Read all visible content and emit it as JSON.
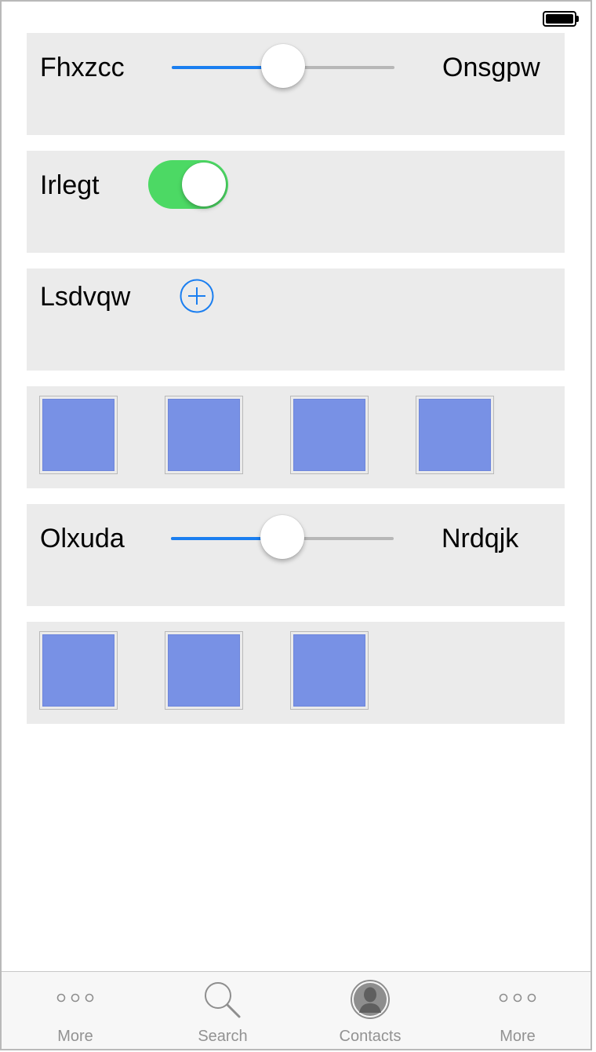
{
  "status_bar": {
    "battery_icon": "battery-full-icon"
  },
  "rows": [
    {
      "type": "slider",
      "left_label": "Fhxzcc",
      "right_label": "Onsgpw",
      "value_fraction": 0.5
    },
    {
      "type": "toggle",
      "label": "Irlegt",
      "on": true
    },
    {
      "type": "add",
      "label": "Lsdvqw",
      "icon": "plus-circle-icon"
    },
    {
      "type": "swatches",
      "count": 4,
      "color": "#7891e5"
    },
    {
      "type": "slider",
      "left_label": "Olxuda",
      "right_label": "Nrdqjk",
      "value_fraction": 0.5
    },
    {
      "type": "swatches",
      "count": 3,
      "color": "#7891e5"
    }
  ],
  "tabbar": {
    "items": [
      {
        "label": "More",
        "icon": "more-dots-icon"
      },
      {
        "label": "Search",
        "icon": "search-icon"
      },
      {
        "label": "Contacts",
        "icon": "contact-icon"
      },
      {
        "label": "More",
        "icon": "more-dots-icon"
      }
    ]
  },
  "colors": {
    "accent": "#1a7ef0",
    "toggle_on": "#4cd964",
    "card_bg": "#ebebeb",
    "swatch": "#7891e5"
  }
}
